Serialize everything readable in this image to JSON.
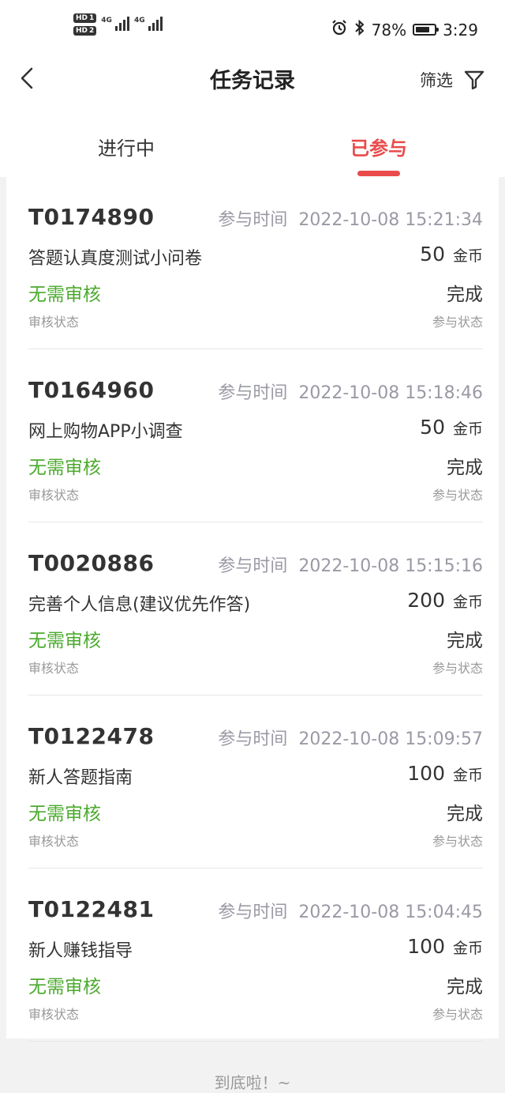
{
  "status_bar": {
    "hd1": "HD",
    "hd1_num": "1",
    "hd2": "HD",
    "hd2_num": "2",
    "net1": "4G",
    "net2": "4G",
    "battery": "78%",
    "battery_level": 0.78,
    "time": "3:29"
  },
  "nav": {
    "title": "任务记录",
    "filter_label": "筛选"
  },
  "tabs": [
    {
      "label": "进行中",
      "active": false
    },
    {
      "label": "已参与",
      "active": true
    }
  ],
  "records": [
    {
      "id": "T0174890",
      "time_label": "参与时间",
      "time": "2022-10-08 15:21:34",
      "title": "答题认真度测试小问卷",
      "amount": "50",
      "unit": "金币",
      "review_value": "无需审核",
      "review_label": "审核状态",
      "status_value": "完成",
      "status_label": "参与状态"
    },
    {
      "id": "T0164960",
      "time_label": "参与时间",
      "time": "2022-10-08 15:18:46",
      "title": "网上购物APP小调查",
      "amount": "50",
      "unit": "金币",
      "review_value": "无需审核",
      "review_label": "审核状态",
      "status_value": "完成",
      "status_label": "参与状态"
    },
    {
      "id": "T0020886",
      "time_label": "参与时间",
      "time": "2022-10-08 15:15:16",
      "title": "完善个人信息(建议优先作答)",
      "amount": "200",
      "unit": "金币",
      "review_value": "无需审核",
      "review_label": "审核状态",
      "status_value": "完成",
      "status_label": "参与状态"
    },
    {
      "id": "T0122478",
      "time_label": "参与时间",
      "time": "2022-10-08 15:09:57",
      "title": "新人答题指南",
      "amount": "100",
      "unit": "金币",
      "review_value": "无需审核",
      "review_label": "审核状态",
      "status_value": "完成",
      "status_label": "参与状态"
    },
    {
      "id": "T0122481",
      "time_label": "参与时间",
      "time": "2022-10-08 15:04:45",
      "title": "新人赚钱指导",
      "amount": "100",
      "unit": "金币",
      "review_value": "无需审核",
      "review_label": "审核状态",
      "status_value": "完成",
      "status_label": "参与状态"
    }
  ],
  "footer": {
    "end_text": "到底啦！~"
  },
  "colors": {
    "accent": "#e94b4b",
    "review_green": "#4caa2e",
    "muted": "#9a9aa6"
  }
}
